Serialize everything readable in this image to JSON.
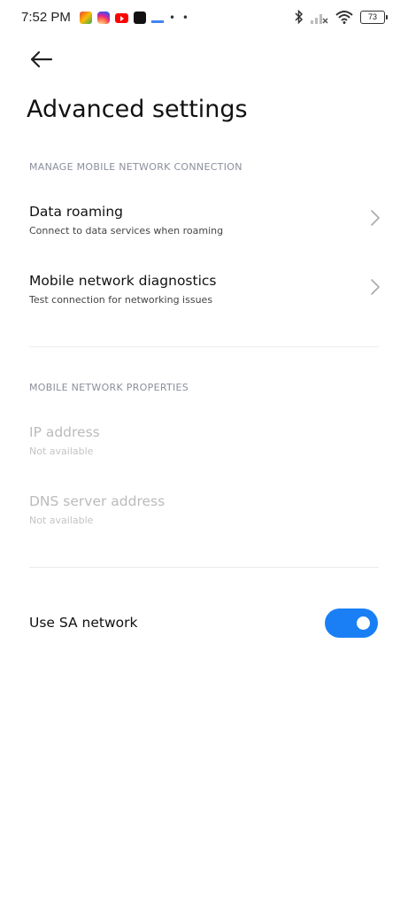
{
  "status_bar": {
    "time": "7:52 PM",
    "notification_icons": [
      "gmail-icon",
      "instagram-icon",
      "youtube-icon",
      "app-icon",
      "app-icon-2",
      "more-dots-icon"
    ],
    "more_dots": "• •",
    "battery": "73",
    "right_icons": [
      "bluetooth-icon",
      "cellular-signal-icon",
      "wifi-icon",
      "battery-icon"
    ]
  },
  "header": {
    "back_icon": "back-arrow-icon",
    "title": "Advanced settings"
  },
  "sections": [
    {
      "header": "MANAGE MOBILE NETWORK CONNECTION",
      "items": [
        {
          "title": "Data roaming",
          "subtitle": "Connect to data services when roaming",
          "enabled": true,
          "chevron": "chevron-right-icon"
        },
        {
          "title": "Mobile network diagnostics",
          "subtitle": "Test connection for networking issues",
          "enabled": true,
          "chevron": "chevron-right-icon"
        }
      ]
    },
    {
      "header": "MOBILE NETWORK PROPERTIES",
      "items": [
        {
          "title": "IP address",
          "subtitle": "Not available",
          "enabled": false
        },
        {
          "title": "DNS server address",
          "subtitle": "Not available",
          "enabled": false
        }
      ]
    }
  ],
  "sa_network": {
    "label": "Use SA network",
    "toggle_on": true
  },
  "colors": {
    "accent": "#1a7ff5",
    "section_header": "#8a8f9c",
    "disabled_text": "#bbbbbb",
    "divider": "#ececec"
  }
}
